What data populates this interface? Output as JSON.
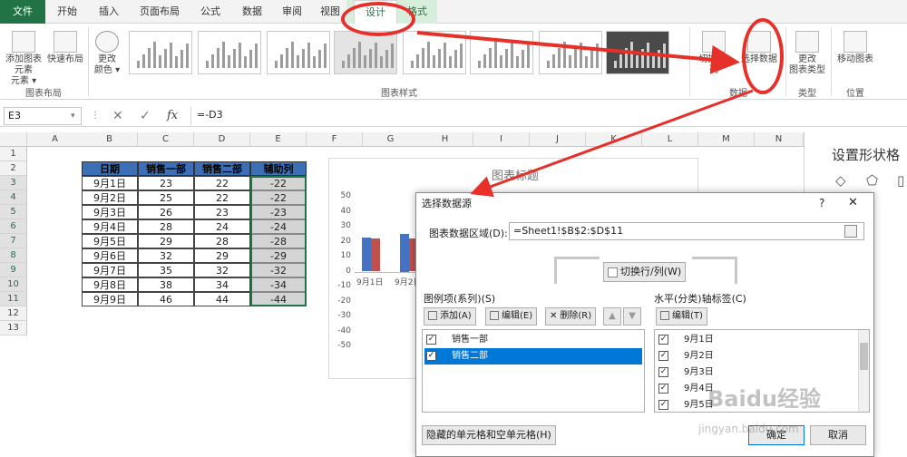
{
  "tabs": [
    "文件",
    "开始",
    "插入",
    "页面布局",
    "公式",
    "数据",
    "审阅",
    "视图",
    "设计",
    "格式"
  ],
  "ribbon": {
    "btn_add_element": "添加图表元素",
    "btn_add_element_2": "元素 ▾",
    "btn_quick_layout": "快速布局",
    "btn_change_colors": "更改",
    "btn_change_colors_2": "颜色 ▾",
    "btn_switch_rowcol": "切换行/列",
    "btn_select_data": "选择数据",
    "btn_change_type": "更改",
    "btn_change_type_2": "图表类型",
    "btn_move_chart": "移动图表",
    "group_layout": "图表布局",
    "group_styles": "图表样式",
    "group_data": "数据",
    "group_type": "类型",
    "group_location": "位置"
  },
  "formula_bar": {
    "name_box": "E3",
    "formula": "=-D3",
    "fx": "fx"
  },
  "columns": [
    "A",
    "B",
    "C",
    "D",
    "E",
    "F",
    "G",
    "H",
    "I",
    "J",
    "K",
    "L",
    "M",
    "N"
  ],
  "rows": [
    "1",
    "2",
    "3",
    "4",
    "5",
    "6",
    "7",
    "8",
    "9",
    "10",
    "11",
    "12",
    "13"
  ],
  "table": {
    "headers": [
      "日期",
      "销售一部",
      "销售二部",
      "辅助列"
    ],
    "rows": [
      [
        "9月1日",
        "23",
        "22",
        "-22"
      ],
      [
        "9月2日",
        "25",
        "22",
        "-22"
      ],
      [
        "9月3日",
        "26",
        "23",
        "-23"
      ],
      [
        "9月4日",
        "28",
        "24",
        "-24"
      ],
      [
        "9月5日",
        "29",
        "28",
        "-28"
      ],
      [
        "9月6日",
        "32",
        "29",
        "-29"
      ],
      [
        "9月7日",
        "35",
        "32",
        "-32"
      ],
      [
        "9月8日",
        "38",
        "34",
        "-34"
      ],
      [
        "9月9日",
        "46",
        "44",
        "-44"
      ]
    ]
  },
  "chart": {
    "title": "图表标题",
    "y_ticks": [
      "50",
      "40",
      "30",
      "20",
      "10",
      "0",
      "-10",
      "-20",
      "-30",
      "-40",
      "-50"
    ],
    "x_labels": [
      "9月1日",
      "9月2日"
    ],
    "colors": {
      "series1": "#4472c4",
      "series2": "#c0504d"
    }
  },
  "pane": {
    "title": "设置形状格"
  },
  "dialog": {
    "title": "选择数据源",
    "help": "?",
    "close": "✕",
    "range_label": "图表数据区域(D):",
    "range_value": "=Sheet1!$B$2:$D$11",
    "switch_btn": "切换行/列(W)",
    "legend_label": "图例项(系列)(S)",
    "axis_label": "水平(分类)轴标签(C)",
    "add_btn": "添加(A)",
    "edit_btn": "编辑(E)",
    "remove_btn": "删除(R)",
    "axis_edit_btn": "编辑(T)",
    "series": [
      "销售一部",
      "销售二部"
    ],
    "categories": [
      "9月1日",
      "9月2日",
      "9月3日",
      "9月4日",
      "9月5日"
    ],
    "hidden_btn": "隐藏的单元格和空单元格(H)",
    "ok_btn": "确定",
    "cancel_btn": "取消"
  },
  "watermark": {
    "logo": "Baidu经验",
    "url": "jingyan.baidu.com"
  }
}
